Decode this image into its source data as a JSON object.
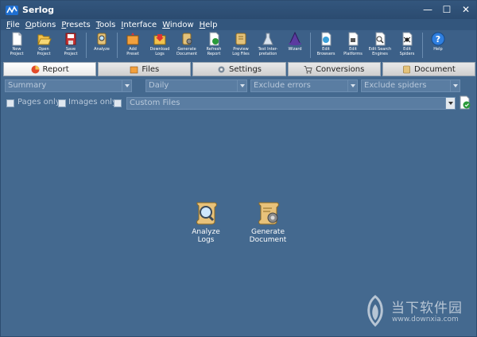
{
  "window": {
    "title": "Serlog",
    "controls": {
      "minimize": "—",
      "maximize": "☐",
      "close": "✕"
    }
  },
  "menu": [
    {
      "mnemonic": "F",
      "rest": "ile"
    },
    {
      "mnemonic": "O",
      "rest": "ptions"
    },
    {
      "mnemonic": "P",
      "rest": "resets"
    },
    {
      "mnemonic": "T",
      "rest": "ools"
    },
    {
      "mnemonic": "I",
      "rest": "nterface"
    },
    {
      "mnemonic": "W",
      "rest": "indow"
    },
    {
      "mnemonic": "H",
      "rest": "elp"
    }
  ],
  "toolbar": [
    {
      "label": "New\nProject",
      "icon": "new-project-icon"
    },
    {
      "label": "Open\nProject",
      "icon": "open-project-icon"
    },
    {
      "label": "Save\nProject",
      "icon": "save-project-icon"
    },
    {
      "label": "Analyze",
      "icon": "analyze-icon"
    },
    {
      "label": "Add\nPreset",
      "icon": "add-preset-icon"
    },
    {
      "label": "Download\nLogs",
      "icon": "download-logs-icon"
    },
    {
      "label": "Generate\nDocument",
      "icon": "generate-document-icon"
    },
    {
      "label": "Refresh\nReport",
      "icon": "refresh-report-icon"
    },
    {
      "label": "Preview\nLog Files",
      "icon": "preview-log-files-icon"
    },
    {
      "label": "Test Inter-\npretation",
      "icon": "test-interpretation-icon"
    },
    {
      "label": "Wizard",
      "icon": "wizard-icon"
    },
    {
      "label": "Edit\nBrowsers",
      "icon": "edit-browsers-icon"
    },
    {
      "label": "Edit\nPlatforms",
      "icon": "edit-platforms-icon"
    },
    {
      "label": "Edit Search\nEngines",
      "icon": "edit-search-engines-icon"
    },
    {
      "label": "Edit\nSpiders",
      "icon": "edit-spiders-icon"
    },
    {
      "label": "Help",
      "icon": "help-icon"
    }
  ],
  "tabs": [
    {
      "label": "Report",
      "active": true
    },
    {
      "label": "Files",
      "active": false
    },
    {
      "label": "Settings",
      "active": false
    },
    {
      "label": "Conversions",
      "active": false
    },
    {
      "label": "Document",
      "active": false
    }
  ],
  "filters": {
    "report_type": "Summary",
    "period": "Daily",
    "errors": "Exclude errors",
    "spiders": "Exclude spiders"
  },
  "options": {
    "pages_only": "Pages only",
    "images_only": "Images only",
    "custom_files": "Custom Files"
  },
  "actions": {
    "analyze_logs": "Analyze\nLogs",
    "generate_document": "Generate\nDocument"
  },
  "watermark": {
    "text": "当下软件园",
    "url": "www.downxia.com"
  },
  "colors": {
    "background": "#44698f",
    "titlebar": "#2b4b70",
    "accent": "#3c6088"
  }
}
